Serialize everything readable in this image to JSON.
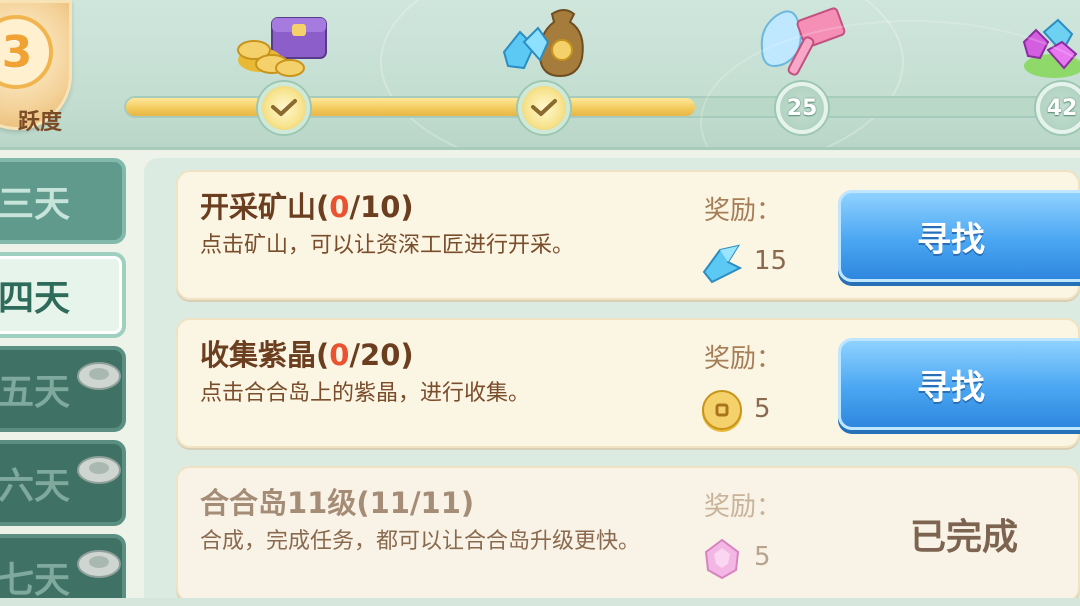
{
  "header": {
    "activity_value": "3",
    "activity_label": "跃度",
    "progress_fraction": 0.595,
    "milestones": [
      {
        "label": "",
        "state": "claimed",
        "icon": "check-icon"
      },
      {
        "label": "",
        "state": "claimed",
        "icon": "check-icon"
      },
      {
        "label": "25",
        "state": "locked"
      },
      {
        "label": "42",
        "state": "locked"
      }
    ],
    "milestone_rewards": [
      "coin-chest-reward",
      "crystal-sack-reward",
      "gem-hammer-reward",
      "gem-pile-reward"
    ]
  },
  "day_tabs": [
    {
      "label": "三天",
      "state": "normal"
    },
    {
      "label": "四天",
      "state": "active"
    },
    {
      "label": "五天",
      "state": "locked"
    },
    {
      "label": "六天",
      "state": "locked"
    },
    {
      "label": "七天",
      "state": "locked"
    }
  ],
  "tasks": [
    {
      "title": "开采矿山(",
      "progress_current": "0",
      "progress_rest": "/10)",
      "description": "点击矿山，可以让资深工匠进行开采。",
      "reward_label": "奖励：",
      "reward_icon": "blue-crystal-icon",
      "reward_amount": "15",
      "action_label": "寻找",
      "status": "in_progress"
    },
    {
      "title": "收集紫晶(",
      "progress_current": "0",
      "progress_rest": "/20)",
      "description": "点击合合岛上的紫晶，进行收集。",
      "reward_label": "奖励：",
      "reward_icon": "gold-coin-icon",
      "reward_amount": "5",
      "action_label": "寻找",
      "status": "in_progress"
    },
    {
      "title": "合合岛11级(11/11)",
      "description": "合成，完成任务，都可以让合合岛升级更快。",
      "reward_label": "奖励：",
      "reward_icon": "pink-gem-icon",
      "reward_amount": "5",
      "done_label": "已完成",
      "status": "completed"
    }
  ],
  "colors": {
    "accent_gold": "#f0a234",
    "progress_fill": "#f3c95a",
    "button_blue": "#4aa6f2",
    "highlight_red": "#ea5331",
    "text_brown": "#6b3e1f"
  }
}
